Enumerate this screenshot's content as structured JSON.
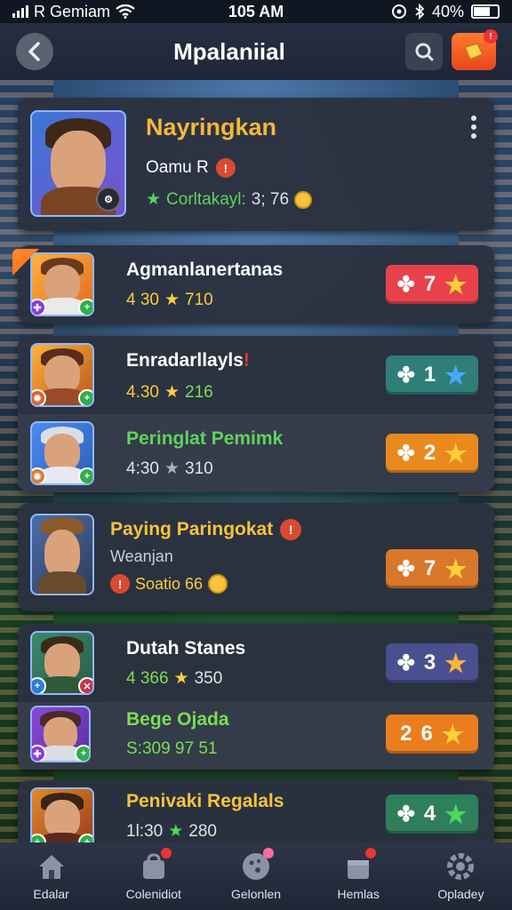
{
  "status_bar": {
    "carrier": "R Gemiam",
    "time": "105 AM",
    "battery": "40%"
  },
  "header": {
    "title": "Mpalaniial"
  },
  "featured": {
    "name": "Nayringkan",
    "subtitle": "Oamu R",
    "stat_label": "Corltakayl:",
    "stat_value": "3; 76"
  },
  "rows": [
    {
      "name": "Agmanlanertanas",
      "stat_left": "4 30",
      "stat_right": "710",
      "rank": "7",
      "rank_color": "#e8414c",
      "star_color": "#ffcf3a",
      "name_color": "#ffffff",
      "stat_color": "#f7cd3a",
      "stat_right_color": "#f7cd3a"
    },
    {
      "name": "Enradarllayls",
      "stat_left": "4.30",
      "stat_right": "216",
      "rank": "1",
      "rank_color": "#2f7e77",
      "star_color": "#49a8ff",
      "name_color": "#ffffff",
      "stat_color": "#f7cd3a",
      "stat_right_color": "#7ddc56"
    },
    {
      "name": "Peringlat Pemimk",
      "stat_left": "4:30",
      "stat_right": "310",
      "rank": "2",
      "rank_color": "#ea8a1e",
      "star_color": "#ffcf3a",
      "name_color": "#5ed45b",
      "stat_color": "#dfe3ea",
      "stat_right_color": "#dfe3ea"
    },
    {
      "name": "Paying Paringokat",
      "subtitle": "Weanjan",
      "stat_left": "Soatio 66",
      "rank": "7",
      "rank_color": "#d9772a",
      "star_color": "#ffcf3a",
      "name_color": "#f7c33a",
      "stat_color": "#f7cd3a"
    },
    {
      "name": "Dutah Stanes",
      "stat_left": "4 366",
      "stat_right": "350",
      "rank": "3",
      "rank_color": "#4a4f8f",
      "star_color": "#ffb53a",
      "name_color": "#ffffff",
      "stat_color": "#7ddc56",
      "stat_right_color": "#dfe3ea"
    },
    {
      "name": "Bege Ojada",
      "stat_left": "S:309 97 51",
      "rank": "2",
      "rank_right": "6",
      "rank_color": "#ea7d1e",
      "star_color": "#ffcf3a",
      "name_color": "#7ddc56",
      "stat_color": "#7ddc56"
    },
    {
      "name": "Penivaki Regalals",
      "stat_left": "1l:30",
      "stat_right": "280",
      "rank": "4",
      "rank_color": "#2f7e5c",
      "star_color": "#4fd85a",
      "name_color": "#f7c33a",
      "stat_color": "#dfe3ea",
      "stat_right_color": "#dfe3ea"
    }
  ],
  "nav": [
    {
      "label": "Edalar",
      "icon": "home-icon"
    },
    {
      "label": "Colenidiot",
      "icon": "bag-icon"
    },
    {
      "label": "Gelonlen",
      "icon": "ball-icon"
    },
    {
      "label": "Hemlas",
      "icon": "chest-icon"
    },
    {
      "label": "Opladey",
      "icon": "gear-icon"
    }
  ]
}
